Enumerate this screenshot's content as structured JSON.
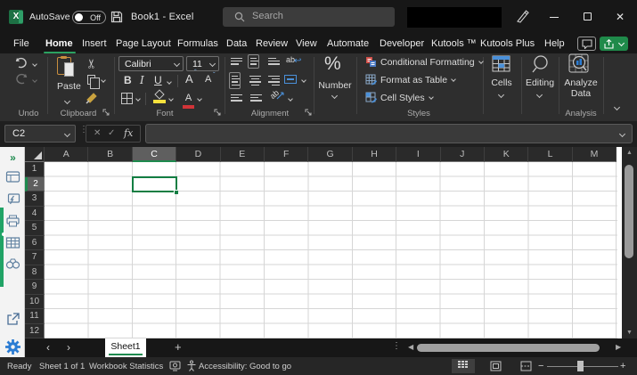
{
  "titlebar": {
    "autosave_label": "AutoSave",
    "autosave_state": "Off",
    "doc_title": "Book1 - Excel"
  },
  "search": {
    "placeholder": "Search"
  },
  "menu": {
    "items": [
      "File",
      "Home",
      "Insert",
      "Page Layout",
      "Formulas",
      "Data",
      "Review",
      "View",
      "Automate",
      "Developer",
      "Kutools ™",
      "Kutools Plus",
      "Help"
    ],
    "active": "Home"
  },
  "ribbon": {
    "undo": {
      "label": "Undo"
    },
    "clipboard": {
      "label": "Clipboard",
      "paste": "Paste"
    },
    "font": {
      "label": "Font",
      "family": "Calibri",
      "size": "11",
      "bold": "B",
      "italic": "I",
      "underline": "U",
      "grow": "A",
      "shrink": "A",
      "color_a": "A"
    },
    "alignment": {
      "label": "Alignment",
      "wrap": "ab",
      "orient": "ab"
    },
    "number": {
      "label": "Number",
      "percent": "%"
    },
    "styles": {
      "label": "Styles",
      "buttons": [
        "Conditional Formatting",
        "Format as Table",
        "Cell Styles"
      ]
    },
    "cells": {
      "label": "Cells"
    },
    "editing": {
      "label": "Editing"
    },
    "analysis": {
      "label": "Analysis",
      "line1": "Analyze",
      "line2": "Data"
    }
  },
  "formula_bar": {
    "name_box": "C2",
    "fx_label": "fx"
  },
  "grid": {
    "columns": [
      "A",
      "B",
      "C",
      "D",
      "E",
      "F",
      "G",
      "H",
      "I",
      "J",
      "K",
      "L",
      "M"
    ],
    "rows": [
      "1",
      "2",
      "3",
      "4",
      "5",
      "6",
      "7",
      "8",
      "9",
      "10",
      "11",
      "12"
    ],
    "selected_column": "C",
    "selected_row": "2",
    "selected_cell": "C2"
  },
  "sheet_tabs": {
    "active_tab": "Sheet1",
    "add_label": "+"
  },
  "status_bar": {
    "mode": "Ready",
    "sheet_info": "Sheet 1 of 1",
    "workbook_statistics": "Workbook Statistics",
    "accessibility": "Accessibility: Good to go"
  },
  "colors": {
    "accent_green": "#1e8a4e",
    "selection_green": "#137e43",
    "share_green": "#1f8a4a"
  }
}
